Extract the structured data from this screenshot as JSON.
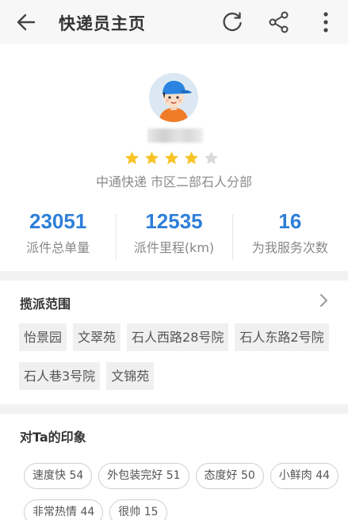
{
  "topbar": {
    "title": "快递员主页",
    "back_icon": "arrow-left-icon",
    "refresh_icon": "refresh-icon",
    "share_icon": "share-icon",
    "more_icon": "more-vertical-icon"
  },
  "profile": {
    "avatar_icon": "courier-avatar-icon",
    "name": "",
    "rating": 4,
    "rating_max": 5,
    "company": "中通快递 市区二部石人分部",
    "stats": [
      {
        "value": "23051",
        "label": "派件总单量"
      },
      {
        "value": "12535",
        "label": "派件里程(km)"
      },
      {
        "value": "16",
        "label": "为我服务次数"
      }
    ]
  },
  "delivery_range": {
    "title": "揽派范围",
    "chevron_icon": "chevron-right-icon",
    "areas": [
      "怡景园",
      "文翠苑",
      "石人西路28号院",
      "石人东路2号院",
      "石人巷3号院",
      "文锦苑"
    ]
  },
  "impressions": {
    "title": "对Ta的印象",
    "tags": [
      "速度快 54",
      "外包装完好 51",
      "态度好 50",
      "小鲜肉 44",
      "非常热情 44",
      "很帅 15"
    ]
  },
  "colors": {
    "accent": "#2f7fd8",
    "star": "#f7c325",
    "star_empty": "#d9d9d9"
  }
}
